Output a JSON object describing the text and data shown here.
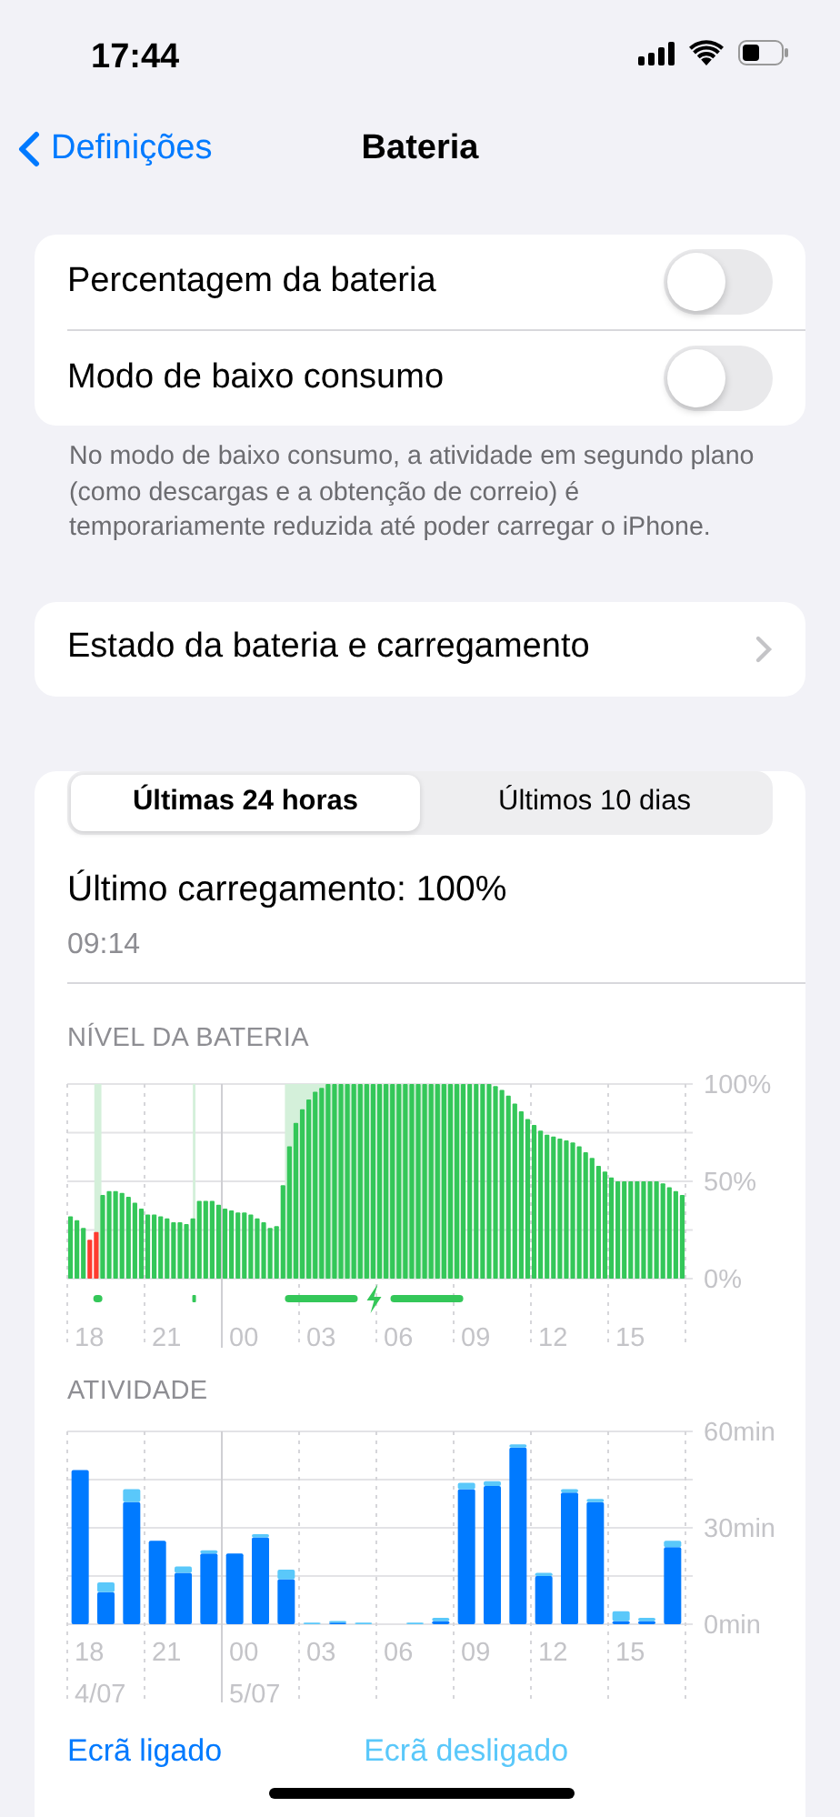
{
  "status_bar": {
    "time": "17:44"
  },
  "nav": {
    "back": "Definições",
    "title": "Bateria"
  },
  "settings": [
    {
      "label": "Percentagem da bateria",
      "on": false
    },
    {
      "label": "Modo de baixo consumo",
      "on": false
    }
  ],
  "settings_footer": "No modo de baixo consumo, a atividade em segundo plano (como descargas e a obtenção de correio) é temporariamente reduzida até poder carregar o iPhone.",
  "health_row": {
    "label": "Estado da bateria e carregamento"
  },
  "usage": {
    "tabs": [
      {
        "label": "Últimas 24 horas",
        "selected": true
      },
      {
        "label": "Últimos 10 dias",
        "selected": false
      }
    ],
    "last_charge": "Último carregamento: 100%",
    "last_charge_time": "09:14",
    "battery_chart": {
      "chart_data": {
        "type": "bar",
        "title": "NÍVEL DA BATERIA",
        "ylim": [
          0,
          100
        ],
        "yticks": [
          {
            "value": 0,
            "label": "0%"
          },
          {
            "value": 50,
            "label": "50%"
          },
          {
            "value": 100,
            "label": "100%"
          }
        ],
        "grid": true,
        "categories": [
          null,
          null,
          null,
          "18",
          null,
          null,
          null,
          null,
          null,
          null,
          null,
          null,
          null,
          null,
          null,
          "21",
          null,
          null,
          null,
          null,
          null,
          null,
          null,
          null,
          null,
          null,
          null,
          "00",
          null,
          null,
          null,
          null,
          null,
          null,
          null,
          null,
          null,
          null,
          null,
          "03",
          null,
          null,
          null,
          null,
          null,
          null,
          null,
          null,
          null,
          null,
          null,
          "06",
          null,
          null,
          null,
          null,
          null,
          null,
          null,
          null,
          null,
          null,
          null,
          "09",
          null,
          null,
          null,
          null,
          null,
          null,
          null,
          null,
          null,
          null,
          null,
          "12",
          null,
          null,
          null,
          null,
          null,
          null,
          null,
          null,
          null,
          null,
          null,
          "15",
          null,
          null,
          null,
          null,
          null,
          null,
          null,
          null
        ],
        "series": [
          {
            "color": "#34c759",
            "values": [
              32,
              30,
              26,
              null,
              null,
              43,
              45,
              45,
              44,
              42,
              39,
              36,
              33,
              33,
              32,
              31,
              29,
              29,
              28,
              31,
              40,
              40,
              40,
              38,
              36,
              35,
              34,
              34,
              33,
              31,
              29,
              26,
              27,
              48,
              68,
              80,
              87,
              92,
              96,
              98,
              100,
              100,
              100,
              100,
              100,
              100,
              100,
              100,
              100,
              100,
              100,
              100,
              100,
              100,
              100,
              100,
              100,
              100,
              100,
              100,
              100,
              100,
              100,
              100,
              100,
              100,
              99,
              97,
              94,
              90,
              86,
              82,
              79,
              76,
              74,
              73,
              72,
              71,
              70,
              68,
              65,
              62,
              58,
              55,
              52,
              50,
              50,
              50,
              50,
              50,
              50,
              50,
              49,
              47,
              45,
              43
            ]
          },
          {
            "color": "#ff3b30",
            "values": [
              null,
              null,
              null,
              20,
              24,
              null,
              null,
              null,
              null,
              null,
              null,
              null,
              null,
              null,
              null,
              null,
              null,
              null,
              null,
              null,
              null,
              null,
              null,
              null,
              null,
              null,
              null,
              null,
              null,
              null,
              null,
              null,
              null,
              null,
              null,
              null,
              null,
              null,
              null,
              null,
              null,
              null,
              null,
              null,
              null,
              null,
              null,
              null,
              null,
              null,
              null,
              null,
              null,
              null,
              null,
              null,
              null,
              null,
              null,
              null,
              null,
              null,
              null,
              null,
              null,
              null,
              null,
              null,
              null,
              null,
              null,
              null,
              null,
              null,
              null,
              null,
              null,
              null,
              null,
              null,
              null,
              null,
              null,
              null,
              null,
              null,
              null,
              null,
              null,
              null,
              null,
              null,
              null,
              null,
              null,
              null
            ]
          }
        ]
      }
    },
    "activity_chart": {
      "chart_data": {
        "type": "bar",
        "title": "ATIVIDADE",
        "stacked": true,
        "ylim": [
          0,
          60
        ],
        "yticks": [
          {
            "value": 0,
            "label": "0min"
          },
          {
            "value": 30,
            "label": "30min"
          },
          {
            "value": 60,
            "label": "60min"
          }
        ],
        "grid": true,
        "categories": [
          "18",
          null,
          null,
          "21",
          null,
          null,
          "00",
          null,
          null,
          "03",
          null,
          null,
          "06",
          null,
          null,
          "09",
          null,
          null,
          "12",
          null,
          null,
          "15",
          null,
          null
        ],
        "series": [
          {
            "name": "Ecrã ligado",
            "color": "#007aff",
            "values": [
              48,
              10,
              38,
              26,
              16,
              22,
              22,
              27,
              14,
              null,
              0.5,
              null,
              null,
              null,
              1,
              42,
              43,
              55,
              15,
              41,
              38,
              1,
              1,
              24
            ]
          },
          {
            "name": "Ecrã desligado",
            "color": "#5ac8fa",
            "values": [
              null,
              3,
              4,
              null,
              2,
              1,
              null,
              1,
              3,
              0.5,
              0.5,
              0.5,
              null,
              0.5,
              1,
              2,
              1.5,
              1,
              1,
              1,
              1,
              3,
              1,
              2
            ]
          }
        ]
      },
      "date_labels": [
        "4/07",
        "5/07"
      ]
    }
  }
}
